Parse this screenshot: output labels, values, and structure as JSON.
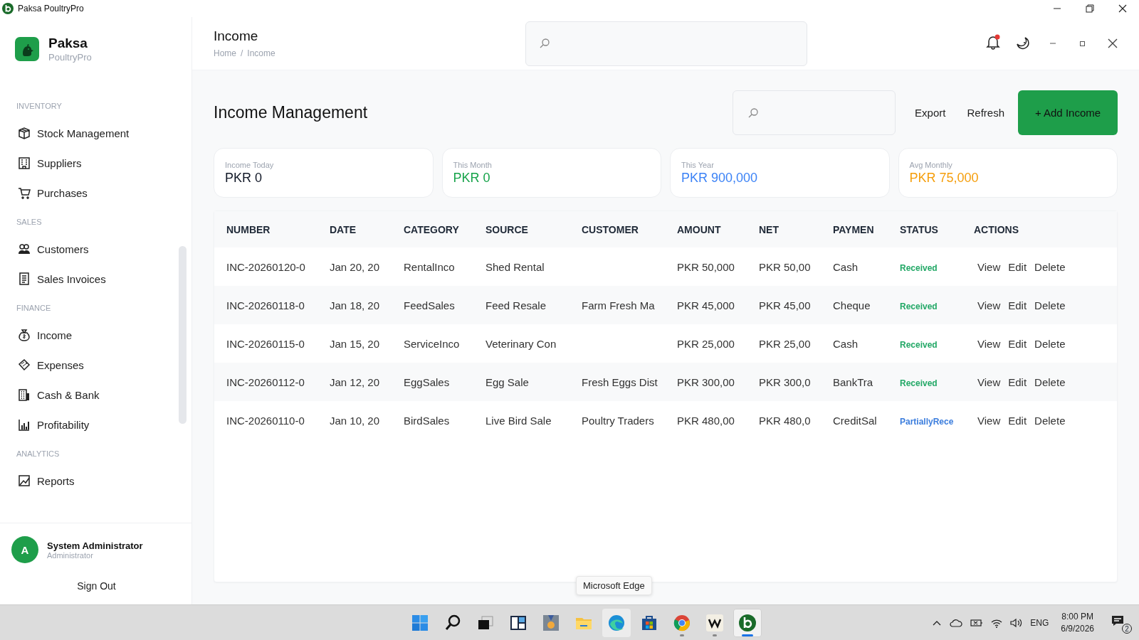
{
  "window": {
    "title": "Paksa PoultryPro"
  },
  "sidebar": {
    "brand": {
      "name": "Paksa",
      "subtitle": "PoultryPro"
    },
    "sections": [
      {
        "heading": "INVENTORY",
        "items": [
          "Stock Management",
          "Suppliers",
          "Purchases"
        ]
      },
      {
        "heading": "SALES",
        "items": [
          "Customers",
          "Sales Invoices"
        ]
      },
      {
        "heading": "FINANCE",
        "items": [
          "Income",
          "Expenses",
          "Cash & Bank",
          "Profitability"
        ]
      },
      {
        "heading": "ANALYTICS",
        "items": [
          "Reports"
        ]
      }
    ],
    "user": {
      "initial": "A",
      "name": "System Administrator",
      "role": "Administrator"
    },
    "sign_out": "Sign Out"
  },
  "header": {
    "title": "Income",
    "breadcrumb": [
      "Home",
      "Income"
    ],
    "breadcrumb_separator": "/",
    "notifications_unread": true
  },
  "page": {
    "title": "Income Management",
    "actions": [
      "Export",
      "Refresh"
    ],
    "primary_action": "+ Add Income"
  },
  "stats": [
    {
      "label": "Income Today",
      "value": "PKR 0",
      "color": "#111827"
    },
    {
      "label": "This Month",
      "value": "PKR 0",
      "color": "#16a34a"
    },
    {
      "label": "This Year",
      "value": "PKR 900,000",
      "color": "#3b82f6"
    },
    {
      "label": "Avg Monthly",
      "value": "PKR 75,000",
      "color": "#f59e0b"
    }
  ],
  "table": {
    "columns": [
      "NUMBER",
      "DATE",
      "CATEGORY",
      "SOURCE",
      "CUSTOMER",
      "AMOUNT",
      "NET",
      "PAYMEN",
      "STATUS",
      "ACTIONS"
    ],
    "rows": [
      {
        "cells": [
          "INC-20260120-0",
          "Jan 20, 20",
          "RentalInco",
          "Shed Rental",
          "",
          "PKR 50,000",
          "PKR 50,00",
          "Cash"
        ],
        "status": {
          "text": "Received",
          "kind": "received"
        },
        "actions": [
          "View",
          "Edit",
          "Delete"
        ]
      },
      {
        "cells": [
          "INC-20260118-0",
          "Jan 18, 20",
          "FeedSales",
          "Feed Resale",
          "Farm Fresh Ma",
          "PKR 45,000",
          "PKR 45,00",
          "Cheque"
        ],
        "status": {
          "text": "Received",
          "kind": "received"
        },
        "actions": [
          "View",
          "Edit",
          "Delete"
        ]
      },
      {
        "cells": [
          "INC-20260115-0",
          "Jan 15, 20",
          "ServiceInco",
          "Veterinary Con",
          "",
          "PKR 25,000",
          "PKR 25,00",
          "Cash"
        ],
        "status": {
          "text": "Received",
          "kind": "received"
        },
        "actions": [
          "View",
          "Edit",
          "Delete"
        ]
      },
      {
        "cells": [
          "INC-20260112-0",
          "Jan 12, 20",
          "EggSales",
          "Egg Sale",
          "Fresh Eggs Dist",
          "PKR 300,00",
          "PKR 300,0",
          "BankTra"
        ],
        "status": {
          "text": "Received",
          "kind": "received"
        },
        "actions": [
          "View",
          "Edit",
          "Delete"
        ]
      },
      {
        "cells": [
          "INC-20260110-0",
          "Jan 10, 20",
          "BirdSales",
          "Live Bird Sale",
          "Poultry Traders",
          "PKR 480,00",
          "PKR 480,0",
          "CreditSal"
        ],
        "status": {
          "text": "PartiallyRece",
          "kind": "partial"
        },
        "actions": [
          "View",
          "Edit",
          "Delete"
        ]
      }
    ]
  },
  "tooltip": "Microsoft Edge",
  "taskbar": {
    "apps": [
      {
        "hovered": false,
        "running": false,
        "selected": false
      },
      {
        "hovered": false,
        "running": false,
        "selected": false
      },
      {
        "hovered": false,
        "running": false,
        "selected": false
      },
      {
        "hovered": false,
        "running": false,
        "selected": false
      },
      {
        "hovered": false,
        "running": false,
        "selected": false
      },
      {
        "hovered": false,
        "running": false,
        "selected": false
      },
      {
        "hovered": true,
        "running": false,
        "selected": false
      },
      {
        "hovered": false,
        "running": false,
        "selected": false
      },
      {
        "hovered": false,
        "running": true,
        "selected": false
      },
      {
        "hovered": false,
        "running": true,
        "selected": false
      },
      {
        "hovered": false,
        "running": true,
        "selected": true
      }
    ],
    "language": "ENG",
    "time": "8:00 PM",
    "date": "6/9/2026",
    "notification_count": "2"
  }
}
